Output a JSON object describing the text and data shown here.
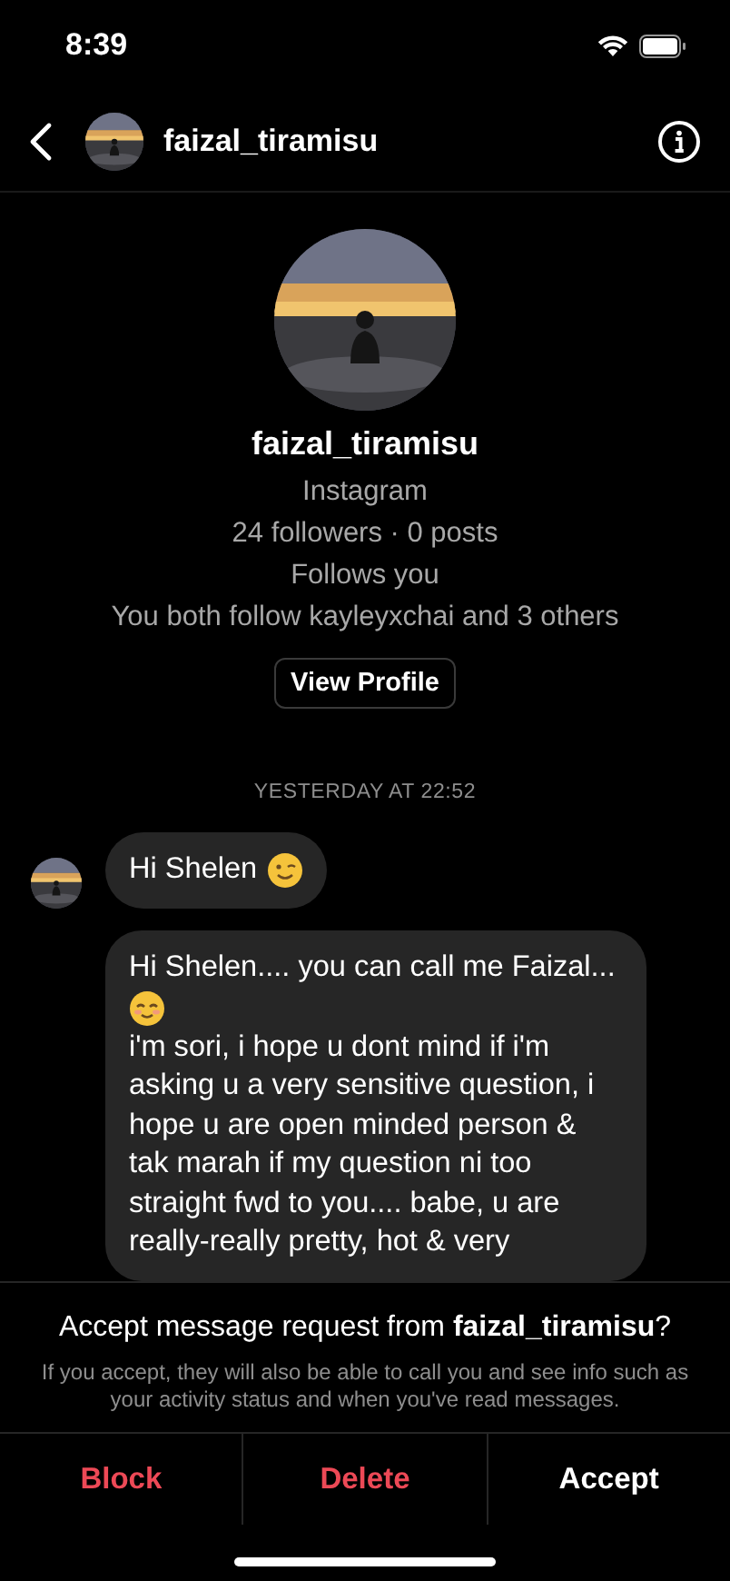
{
  "status_bar": {
    "time": "8:39"
  },
  "header": {
    "username": "faizal_tiramisu"
  },
  "profile": {
    "name": "faizal_tiramisu",
    "lines": [
      "Instagram",
      "24 followers · 0 posts",
      "Follows you",
      "You both follow kayleyxchai and 3 others"
    ],
    "button": "View Profile"
  },
  "timestamp": "YESTERDAY AT 22:52",
  "messages": [
    {
      "show_avatar": true,
      "parts": [
        {
          "kind": "text",
          "text": "Hi Shelen"
        },
        {
          "kind": "wink_emoji"
        }
      ]
    },
    {
      "show_avatar": false,
      "parts": [
        {
          "kind": "text",
          "text": "Hi Shelen.... you can call me Faizal..."
        },
        {
          "kind": "smile_emoji"
        },
        {
          "kind": "text",
          "text": "i'm sori, i hope u dont mind if i'm asking u a very sensitive question, i hope u are open minded person & tak marah if my question ni too straight fwd to you.... babe, u are really-really pretty, hot & very"
        }
      ]
    }
  ],
  "request": {
    "title": "Accept message request from **faizal_tiramisu**?",
    "info": "If you accept, they will also be able to call you and see info such as your activity status and when you've read messages.",
    "actions": [
      {
        "label": "Block",
        "kind": "destructive"
      },
      {
        "label": "Delete",
        "kind": "destructive"
      },
      {
        "label": "Accept",
        "kind": "primary"
      }
    ]
  }
}
